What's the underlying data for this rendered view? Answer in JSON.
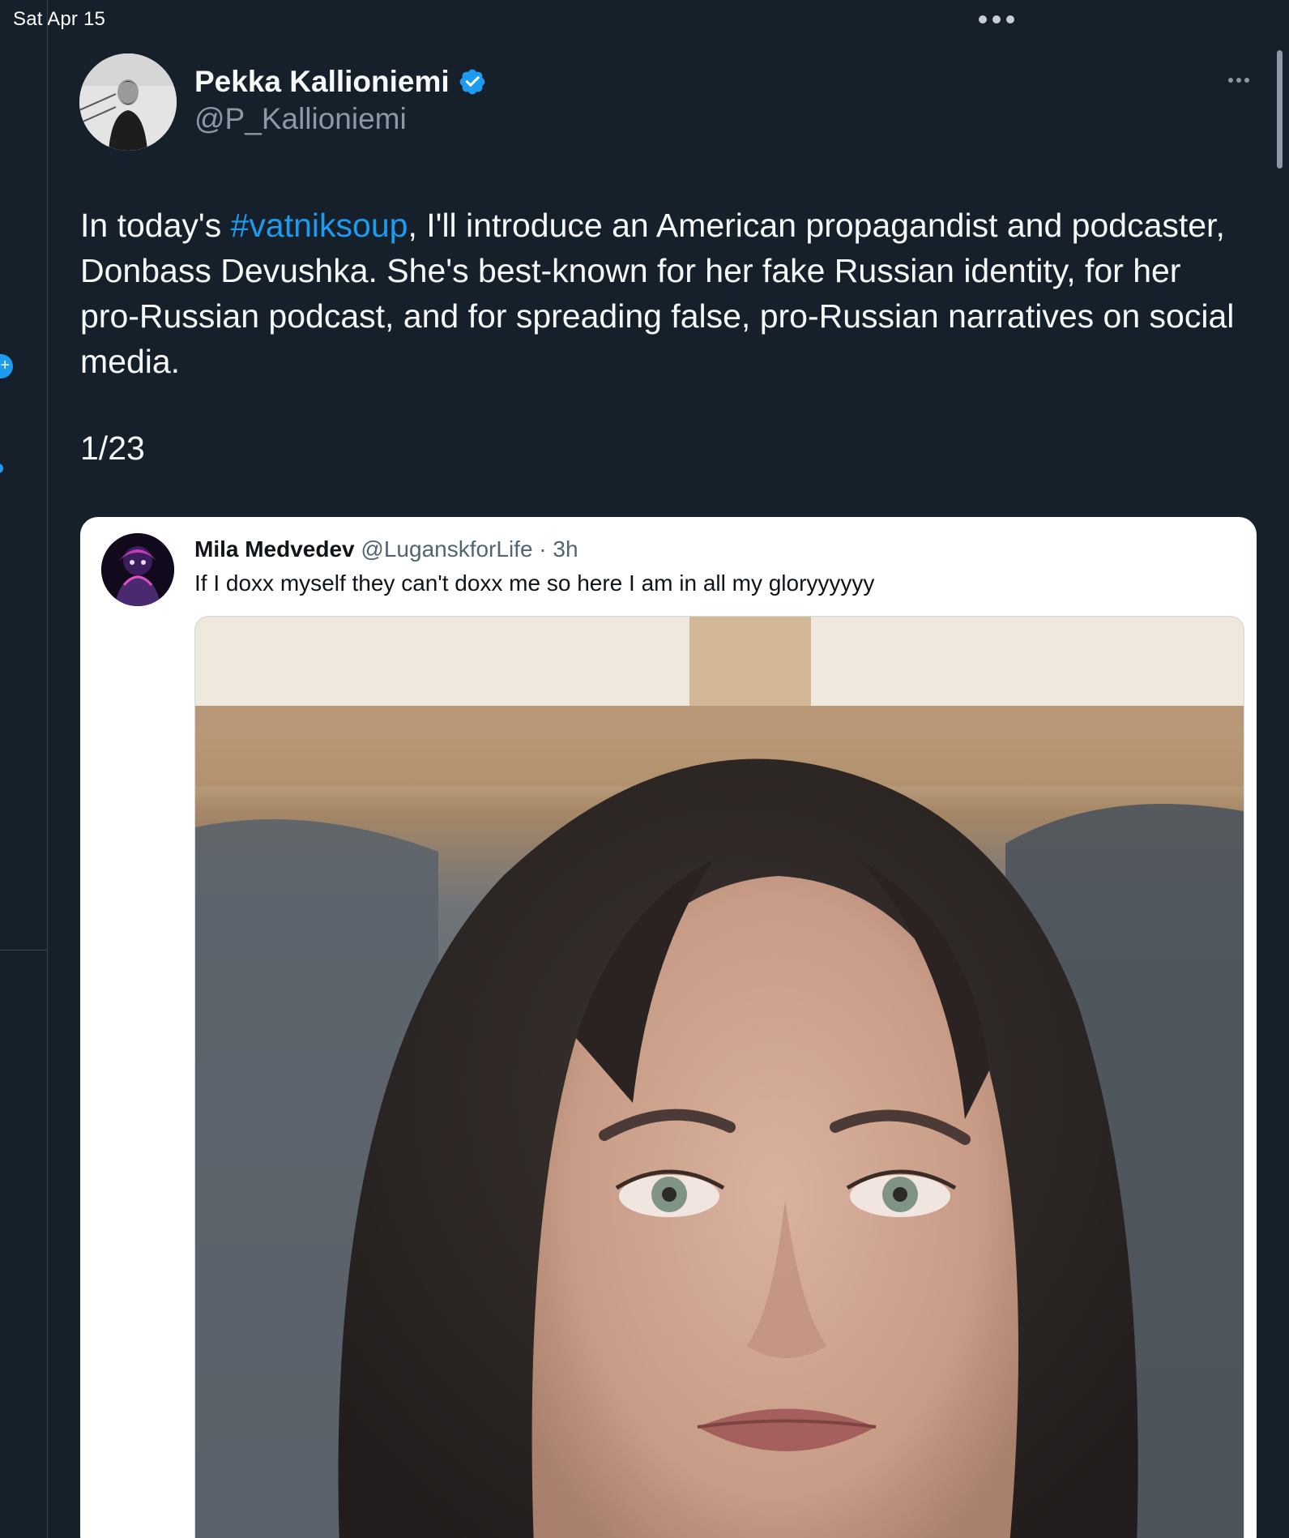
{
  "status_bar": {
    "time": "Sat Apr 15"
  },
  "tweet": {
    "author_name": "Pekka Kallioniemi",
    "author_handle": "@P_Kallioniemi",
    "verified": true,
    "body_before": "In today's ",
    "hashtag": "#vatniksoup",
    "body_after": ", I'll introduce an American propagandist and podcaster, Donbass Devushka. She's best-known for her fake Russian identity, for her pro-Russian podcast, and for spreading false, pro-Russian narratives on social media.",
    "thread_count": "1/23"
  },
  "embedded_tweet": {
    "author_name": "Mila Medvedev",
    "author_handle": "@LuganskforLife",
    "separator": " · ",
    "time": "3h",
    "text": "If I doxx myself they can't doxx me so here I am in all my gloryyyyyy"
  },
  "colors": {
    "background": "#15202b",
    "text": "#f7f9f9",
    "secondary_text": "#8b98a5",
    "accent": "#1d9bf0"
  },
  "icons": {
    "verified": "verified-badge-icon",
    "more": "more-options-icon",
    "window_handle": "window-handle-icon"
  }
}
